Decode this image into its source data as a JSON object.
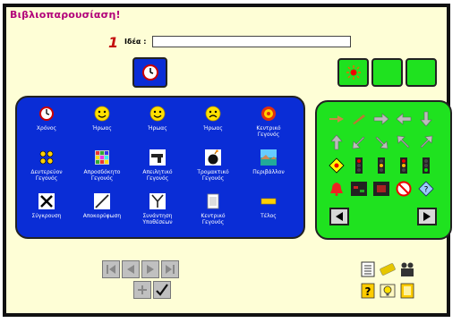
{
  "header": {
    "title": "Βιβλιοπαρουσίαση!",
    "step_number": "1",
    "idea_label": "Ιδέα :"
  },
  "idea_input": {
    "value": ""
  },
  "blue_panel": {
    "items": [
      {
        "label": "Χρόνος",
        "icon": "clock-icon"
      },
      {
        "label": "Ήρωας",
        "icon": "smiley-icon"
      },
      {
        "label": "Ήρωας",
        "icon": "smiley-icon"
      },
      {
        "label": "Ήρωας",
        "icon": "sad-face-icon"
      },
      {
        "label": "Κεντρικό\nΓεγονός",
        "icon": "target-icon"
      },
      {
        "label": "Δευτερεύον\nΓεγονός",
        "icon": "dots-icon"
      },
      {
        "label": "Απροσδόκητο\nΓεγονός",
        "icon": "mosaic-icon"
      },
      {
        "label": "Απειλητικό\nΓεγονός",
        "icon": "gun-icon"
      },
      {
        "label": "Τρομακτικό\nΓεγονός",
        "icon": "bomb-icon"
      },
      {
        "label": "Περιβάλλον",
        "icon": "landscape-icon"
      },
      {
        "label": "Σύγκρουση",
        "icon": "cross-icon"
      },
      {
        "label": "Αποκορύφωση",
        "icon": "rising-line-icon"
      },
      {
        "label": "Συνάντηση\nΥποθέσεων",
        "icon": "merge-icon"
      },
      {
        "label": "Κεντρικό\nΓεγονός",
        "icon": "document-icon"
      },
      {
        "label": "Τέλος",
        "icon": "end-icon"
      }
    ]
  },
  "colors": {
    "title": "#b2007a",
    "number": "#c41010",
    "panel_blue": "#0a2dd6",
    "panel_green": "#1fe21f",
    "frame_bg": "#fefed6"
  }
}
